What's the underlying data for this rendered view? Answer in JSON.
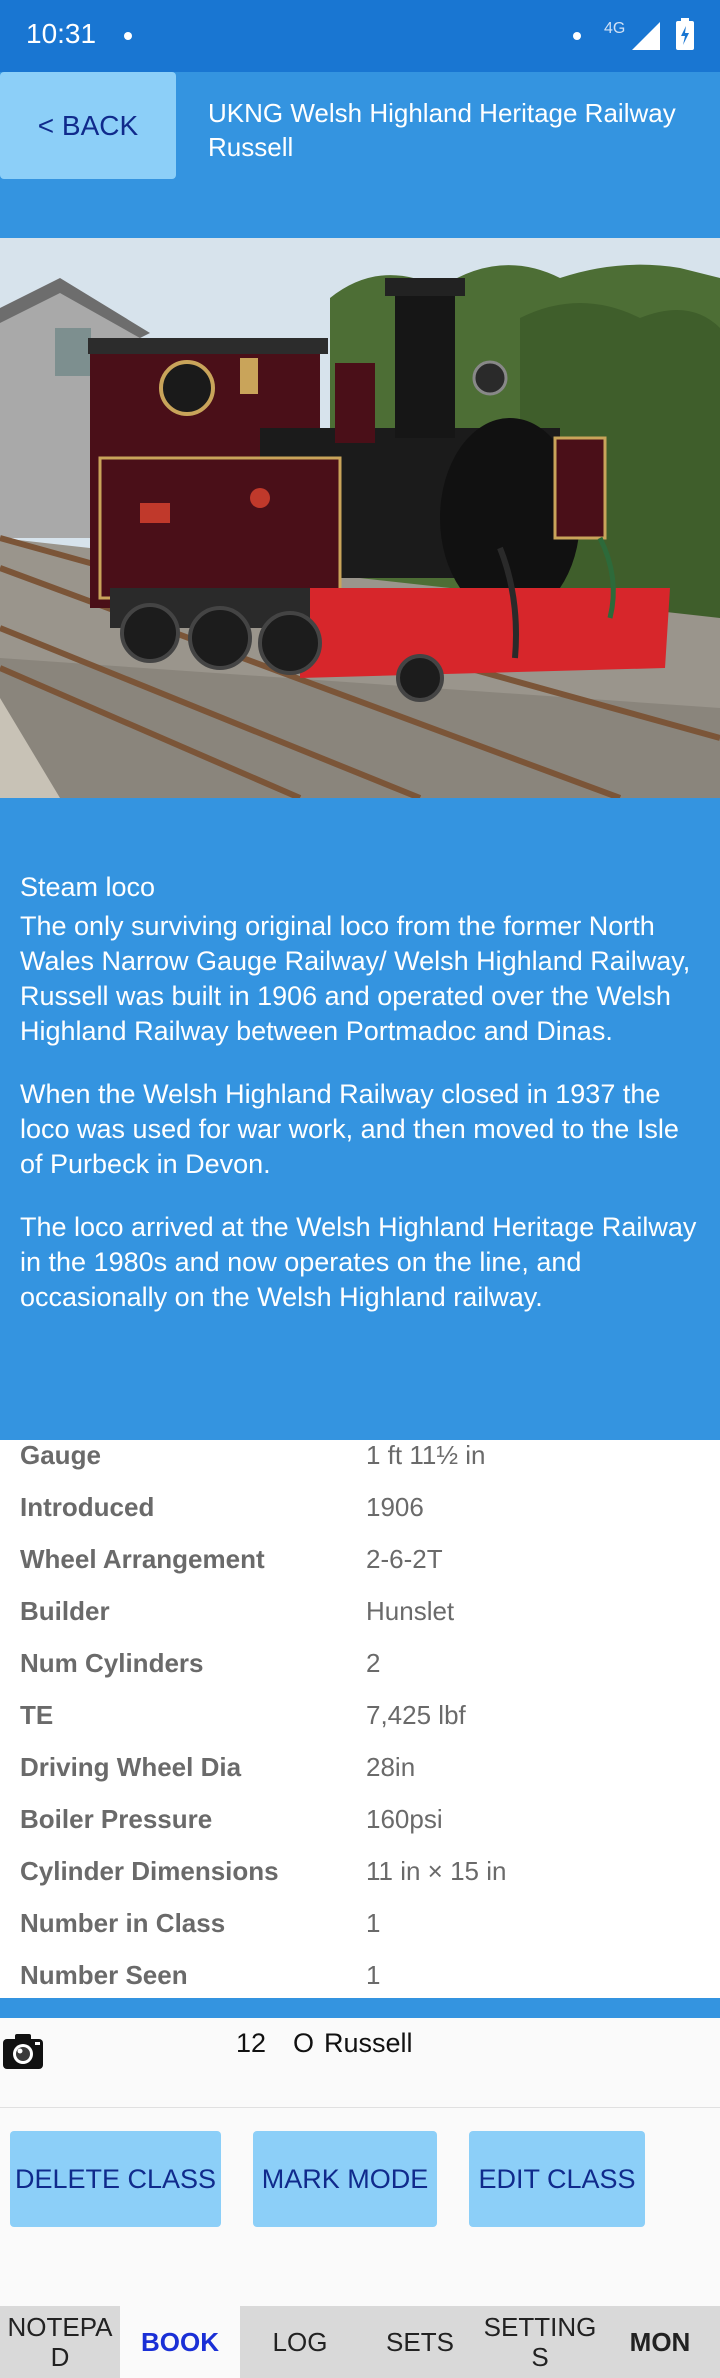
{
  "status_bar": {
    "time": "10:31",
    "network": "4G"
  },
  "header": {
    "back_label": "< BACK",
    "title": "UKNG Welsh Highland Heritage Railway Russell"
  },
  "description": {
    "type": "Steam loco",
    "paragraphs": [
      "The only surviving original loco from the former North Wales Narrow Gauge Railway/ Welsh Highland Railway, Russell was built in 1906 and operated over the Welsh Highland Railway between Portmadoc and Dinas.",
      "When the Welsh Highland Railway closed in 1937 the loco was used for war work, and then moved to the Isle of Purbeck in Devon.",
      "The loco arrived at the Welsh Highland Heritage Railway in the 1980s and now operates on the line, and occasionally on the Welsh Highland railway."
    ]
  },
  "specs": [
    {
      "label": "Gauge",
      "value": "1 ft 11½ in"
    },
    {
      "label": "Introduced",
      "value": "1906"
    },
    {
      "label": "Wheel Arrangement",
      "value": "2-6-2T"
    },
    {
      "label": "Builder",
      "value": "Hunslet"
    },
    {
      "label": "Num Cylinders",
      "value": "2"
    },
    {
      "label": "TE",
      "value": "7,425 lbf"
    },
    {
      "label": "Driving Wheel Dia",
      "value": "28in"
    },
    {
      "label": "Boiler Pressure",
      "value": "160psi"
    },
    {
      "label": "Cylinder Dimensions",
      "value": "11 in × 15 in"
    },
    {
      "label": "Number in Class",
      "value": "1"
    },
    {
      "label": "Number Seen",
      "value": "1"
    }
  ],
  "seen_entry": {
    "count": "12",
    "marker": "O",
    "name": "Russell"
  },
  "actions": {
    "delete_class": "DELETE CLASS",
    "mark_mode": "MARK MODE",
    "edit_class": "EDIT CLASS"
  },
  "tabs": [
    {
      "label": "NOTEPA\nD"
    },
    {
      "label": "BOOK"
    },
    {
      "label": "LOG"
    },
    {
      "label": "SETS"
    },
    {
      "label": "SETTING\nS"
    },
    {
      "label": "MON"
    }
  ],
  "colors": {
    "primary": "#3494e0",
    "status_bar": "#1976d2",
    "button": "#8ccff8",
    "button_text": "#102a8c",
    "active_tab_text": "#1a2fd6"
  }
}
